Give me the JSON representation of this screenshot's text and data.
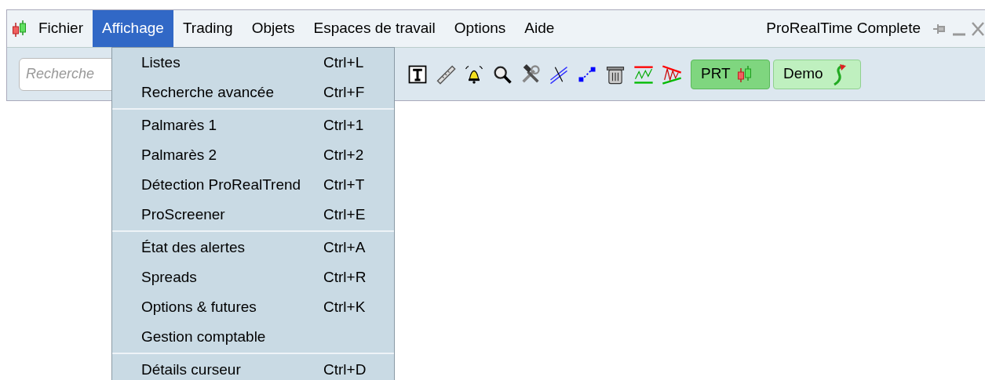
{
  "menu_bar": [
    {
      "label": "Fichier",
      "selected": false
    },
    {
      "label": "Affichage",
      "selected": true
    },
    {
      "label": "Trading",
      "selected": false
    },
    {
      "label": "Objets",
      "selected": false
    },
    {
      "label": "Espaces de travail",
      "selected": false
    },
    {
      "label": "Options",
      "selected": false
    },
    {
      "label": "Aide",
      "selected": false
    }
  ],
  "window": {
    "title": "ProRealTime Complete"
  },
  "search": {
    "placeholder": "Recherche"
  },
  "toolbar_buttons": [
    {
      "label": "PRT",
      "kind": "prt"
    },
    {
      "label": "Demo",
      "kind": "demo"
    }
  ],
  "dropdown": {
    "groups": [
      [
        {
          "label": "Listes",
          "shortcut": "Ctrl+L"
        },
        {
          "label": "Recherche avancée",
          "shortcut": "Ctrl+F"
        }
      ],
      [
        {
          "label": "Palmarès 1",
          "shortcut": "Ctrl+1"
        },
        {
          "label": "Palmarès 2",
          "shortcut": "Ctrl+2"
        },
        {
          "label": "Détection ProRealTrend",
          "shortcut": "Ctrl+T"
        },
        {
          "label": "ProScreener",
          "shortcut": "Ctrl+E"
        }
      ],
      [
        {
          "label": "État des alertes",
          "shortcut": "Ctrl+A"
        },
        {
          "label": "Spreads",
          "shortcut": "Ctrl+R"
        },
        {
          "label": "Options & futures",
          "shortcut": "Ctrl+K"
        },
        {
          "label": "Gestion comptable"
        }
      ],
      [
        {
          "label": "Détails curseur",
          "shortcut": "Ctrl+D"
        }
      ]
    ]
  }
}
